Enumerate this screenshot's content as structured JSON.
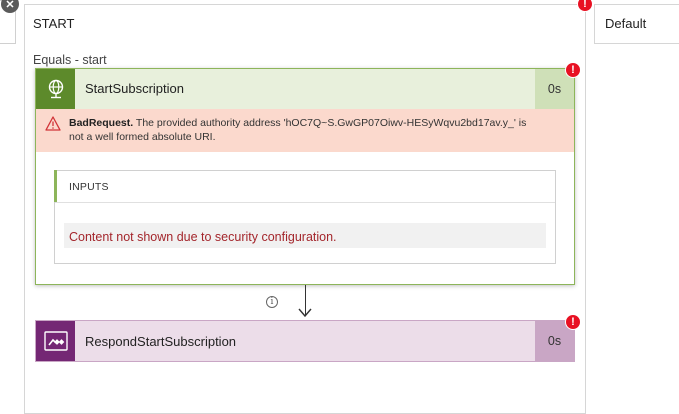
{
  "left_panel": {
    "close_glyph": "✕"
  },
  "start_case": {
    "title": "START",
    "error_glyph": "!"
  },
  "default_case": {
    "title": "Default"
  },
  "condition_label": "Equals - start",
  "start_subscription": {
    "title": "StartSubscription",
    "duration": "0s",
    "error_glyph": "!",
    "icon": "globe-icon",
    "error": {
      "code": "BadRequest.",
      "message": " The provided authority address 'hOC7Q~S.GwGP07Oiwv-HESyWqvu2bd17av.y_' is not a well formed absolute URI."
    },
    "inputs": {
      "label": "INPUTS",
      "secure_message": "Content not shown due to security configuration."
    }
  },
  "connector": {
    "info_glyph": "i"
  },
  "respond_start_subscription": {
    "title": "RespondStartSubscription",
    "duration": "0s",
    "error_glyph": "!",
    "icon": "response-icon"
  },
  "colors": {
    "http_action": "#5d8a2b",
    "http_header_bg": "#e8f0dc",
    "response_action": "#742774",
    "response_bg": "#ecdde9",
    "error_band": "#fbd9cd",
    "error_badge": "#e81123",
    "secure_text": "#a4262c"
  }
}
